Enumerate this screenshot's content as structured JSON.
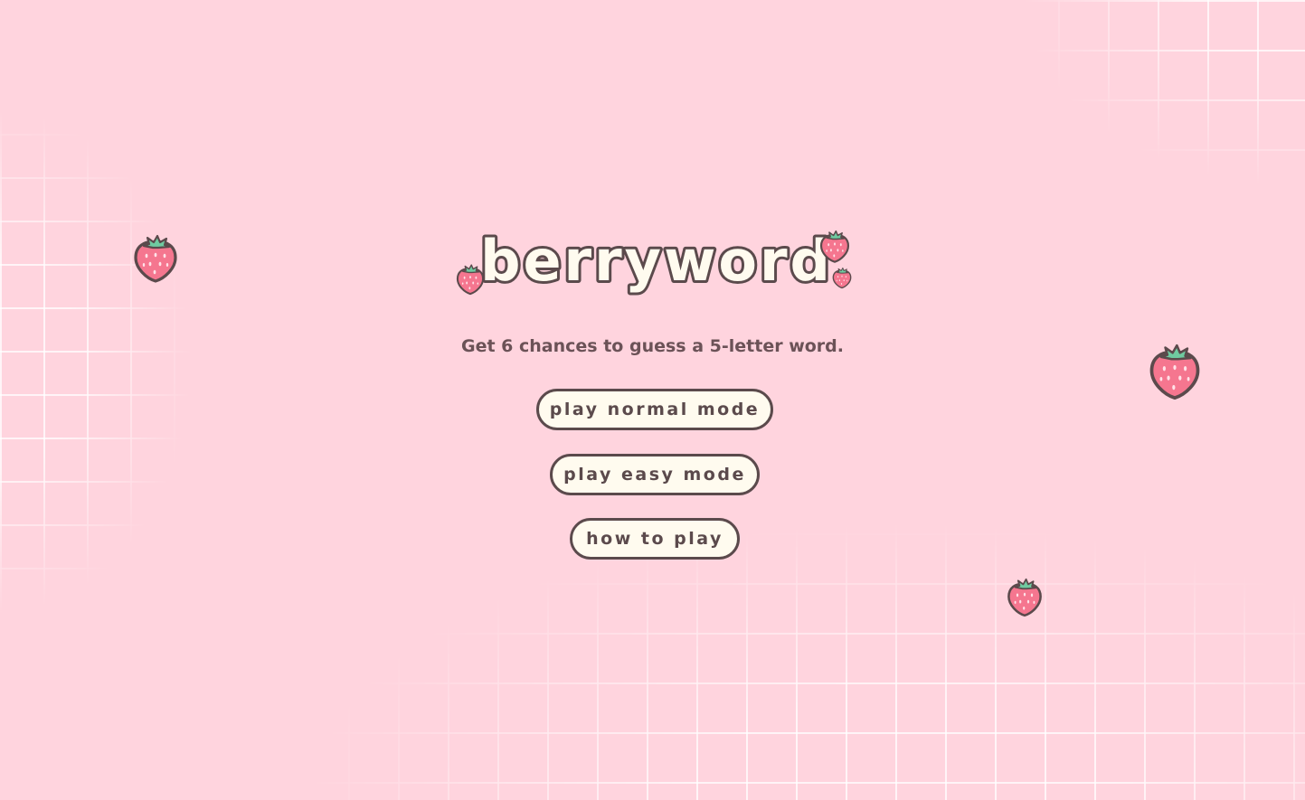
{
  "logo": {
    "text": "berryword"
  },
  "intro": {
    "subtitle": "Get 6 chances to guess a 5-letter word."
  },
  "menu": {
    "normal_label": "play normal mode",
    "easy_label": "play easy mode",
    "howto_label": "how to play"
  },
  "colors": {
    "background": "#ffd4de",
    "button_fill": "#fffbef",
    "outline": "#5b4a4c",
    "text": "#6b5257",
    "berry": "#f5768f",
    "leaf": "#6fcaa0"
  },
  "icons": {
    "decoration": "strawberry-icon"
  }
}
